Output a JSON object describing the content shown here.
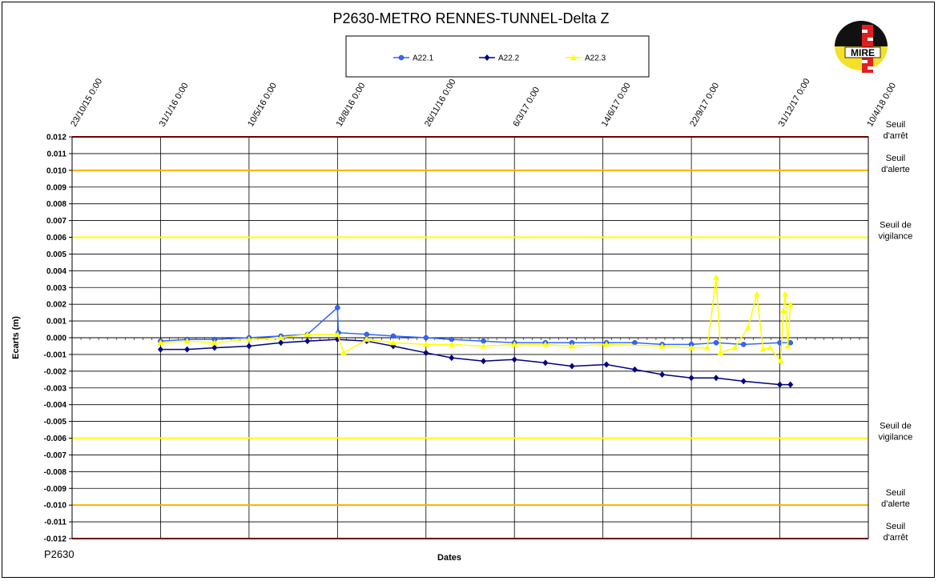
{
  "chart_data": {
    "type": "line",
    "title": "P2630-METRO  RENNES-TUNNEL-Delta  Z",
    "xlabel": "Dates",
    "ylabel": "Ecarts (m)",
    "footer_label": "P2630",
    "logo_text": "MIRE",
    "ylim": [
      -0.012,
      0.012
    ],
    "y_ticks": [
      "0.012",
      "0.011",
      "0.010",
      "0.009",
      "0.008",
      "0.007",
      "0.006",
      "0.005",
      "0.004",
      "0.003",
      "0.002",
      "0.001",
      "0.000",
      "-0.001",
      "-0.002",
      "-0.003",
      "-0.004",
      "-0.005",
      "-0.006",
      "-0.007",
      "-0.008",
      "-0.009",
      "-0.010",
      "-0.011",
      "-0.012"
    ],
    "x_ticks": [
      "23/10/15 0:00",
      "31/1/16 0:00",
      "10/5/16 0:00",
      "18/8/16 0:00",
      "26/11/16 0:00",
      "6/3/17 0:00",
      "14/6/17 0:00",
      "22/9/17 0:00",
      "31/12/17 0:00",
      "10/4/18 0:00"
    ],
    "legend_position": "top-center",
    "grid": true,
    "thresholds": [
      {
        "value": 0.012,
        "color": "#e00000",
        "label_line1": "Seuil",
        "label_line2": "d'arrêt"
      },
      {
        "value": 0.01,
        "color": "#ffb000",
        "label_line1": "Seuil",
        "label_line2": "d'alerte"
      },
      {
        "value": 0.006,
        "color": "#ffff00",
        "label_line1": "Seuil de",
        "label_line2": "vigilance"
      },
      {
        "value": -0.006,
        "color": "#ffff00",
        "label_line1": "Seuil de",
        "label_line2": "vigilance"
      },
      {
        "value": -0.01,
        "color": "#ffb000",
        "label_line1": "Seuil",
        "label_line2": "d'alerte"
      },
      {
        "value": -0.012,
        "color": "#e00000",
        "label_line1": "Seuil",
        "label_line2": "d'arrêt"
      }
    ],
    "series": [
      {
        "name": "A22.1",
        "color": "#3366ff",
        "marker": "circle",
        "x": [
          "2016-01-31",
          "2016-03-01",
          "2016-04-01",
          "2016-05-10",
          "2016-06-15",
          "2016-07-15",
          "2016-08-18",
          "2016-08-19",
          "2016-09-20",
          "2016-10-20",
          "2016-11-26",
          "2016-12-25",
          "2017-01-30",
          "2017-03-06",
          "2017-04-10",
          "2017-05-10",
          "2017-06-18",
          "2017-07-20",
          "2017-08-20",
          "2017-09-22",
          "2017-10-20",
          "2017-11-20",
          "2017-12-31",
          "2018-01-12"
        ],
        "y": [
          -0.0002,
          -0.0001,
          -0.0001,
          0.0,
          0.0001,
          0.0002,
          0.0018,
          0.0003,
          0.0002,
          0.0001,
          0.0,
          -0.0001,
          -0.0002,
          -0.0003,
          -0.0003,
          -0.0003,
          -0.0003,
          -0.0003,
          -0.0004,
          -0.0004,
          -0.0003,
          -0.0004,
          -0.0003,
          -0.0003
        ]
      },
      {
        "name": "A22.2",
        "color": "#000080",
        "marker": "diamond",
        "x": [
          "2016-01-31",
          "2016-03-01",
          "2016-04-01",
          "2016-05-10",
          "2016-06-15",
          "2016-07-15",
          "2016-08-18",
          "2016-09-20",
          "2016-10-20",
          "2016-11-26",
          "2016-12-25",
          "2017-01-30",
          "2017-03-06",
          "2017-04-10",
          "2017-05-10",
          "2017-06-18",
          "2017-07-20",
          "2017-08-20",
          "2017-09-22",
          "2017-10-20",
          "2017-11-20",
          "2017-12-31",
          "2018-01-12"
        ],
        "y": [
          -0.0007,
          -0.0007,
          -0.0006,
          -0.0005,
          -0.0003,
          -0.0002,
          -0.0001,
          -0.0002,
          -0.0005,
          -0.0009,
          -0.0012,
          -0.0014,
          -0.0013,
          -0.0015,
          -0.0017,
          -0.0016,
          -0.0019,
          -0.0022,
          -0.0024,
          -0.0024,
          -0.0026,
          -0.0028,
          -0.0028
        ]
      },
      {
        "name": "A22.3",
        "color": "#ffff00",
        "marker": "triangle",
        "x": [
          "2016-01-31",
          "2016-03-01",
          "2016-04-01",
          "2016-05-10",
          "2016-06-15",
          "2016-07-15",
          "2016-08-18",
          "2016-08-25",
          "2016-09-20",
          "2016-10-20",
          "2016-11-26",
          "2016-12-25",
          "2017-01-30",
          "2017-03-06",
          "2017-04-10",
          "2017-05-10",
          "2017-06-18",
          "2017-08-20",
          "2017-09-22",
          "2017-10-10",
          "2017-10-20",
          "2017-10-25",
          "2017-11-10",
          "2017-11-25",
          "2017-12-05",
          "2017-12-12",
          "2017-12-20",
          "2018-01-01",
          "2018-01-04",
          "2018-01-06",
          "2018-01-09",
          "2018-01-12"
        ],
        "y": [
          -0.0003,
          -0.0002,
          -0.0003,
          -0.0001,
          0.0,
          0.0002,
          0.0002,
          -0.0009,
          -0.0001,
          -0.0003,
          -0.0004,
          -0.0004,
          -0.0005,
          -0.0004,
          -0.0004,
          -0.0005,
          -0.0004,
          -0.0005,
          -0.0006,
          -0.0006,
          0.0036,
          -0.0009,
          -0.0006,
          0.0006,
          0.0026,
          -0.0007,
          -0.0006,
          -0.0014,
          0.0016,
          0.0026,
          -0.0005,
          0.002
        ]
      }
    ]
  }
}
